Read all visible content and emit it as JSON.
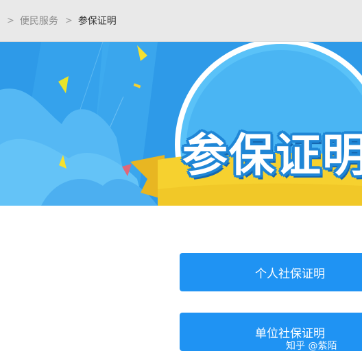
{
  "breadcrumb": {
    "items": [
      {
        "label": "便民服务",
        "current": false
      },
      {
        "label": "参保证明",
        "current": true
      }
    ],
    "separator": ">"
  },
  "banner": {
    "title": "参保证明",
    "colors": {
      "sky": "#2e9ae8",
      "light_blue": "#5cc0f7",
      "ribbon": "#f6d12f",
      "outline": "#1f86d6"
    }
  },
  "actions": {
    "personal_label": "个人社保证明",
    "company_label": "单位社保证明",
    "button_color": "#1f93f3"
  },
  "watermark": {
    "text": "知乎 @紫陌"
  }
}
